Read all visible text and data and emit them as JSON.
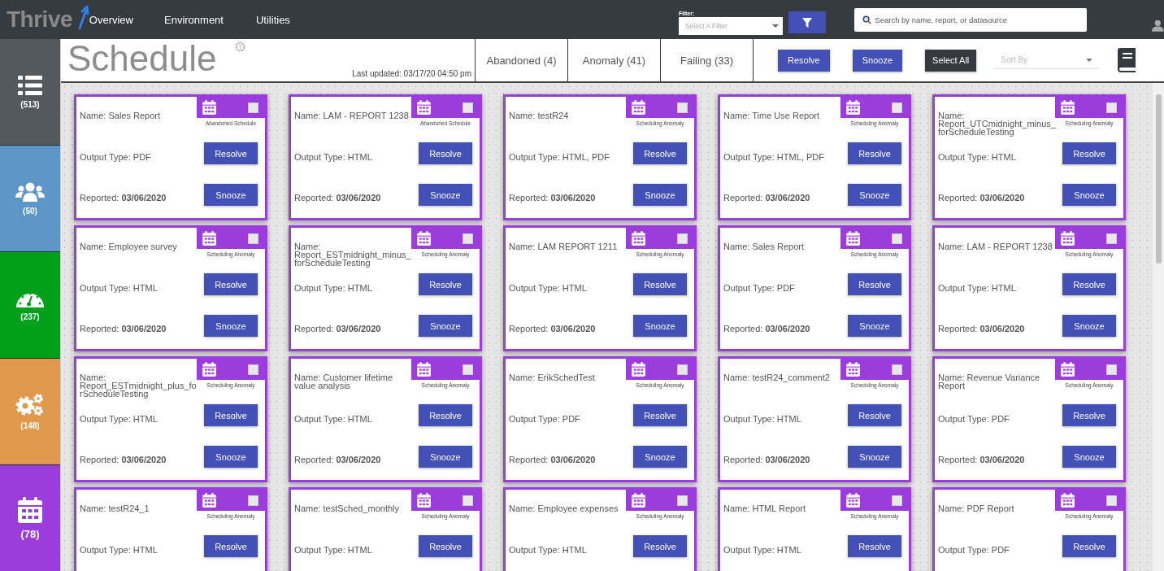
{
  "topbar": {
    "logo": "Thrive",
    "nav": [
      "Overview",
      "Environment",
      "Utilities"
    ],
    "filter": {
      "label": "Filter:",
      "placeholder": "Select A Filter"
    },
    "search": {
      "placeholder": "Search by name, report, or datasource"
    }
  },
  "sidebar": {
    "items": [
      {
        "kind": "list",
        "count": "(513)",
        "color": "#54595d"
      },
      {
        "kind": "users",
        "count": "(50)",
        "color": "#5b96c6"
      },
      {
        "kind": "gauge",
        "count": "(237)",
        "color": "#00a01b"
      },
      {
        "kind": "gears",
        "count": "(148)",
        "color": "#e0984a"
      },
      {
        "kind": "calendar",
        "count": "(78)",
        "color": "#9b3ddc"
      }
    ]
  },
  "header": {
    "title": "Schedule",
    "help": "?",
    "last_updated": "Last updated: 03/17/20 04:50 pm",
    "tabs": [
      {
        "label": "Abandoned (4)",
        "selected": false
      },
      {
        "label": "Anomaly (41)",
        "selected": false
      },
      {
        "label": "Failing (33)",
        "selected": false
      }
    ],
    "actions": [
      {
        "kind": "primary",
        "label": "Resolve"
      },
      {
        "kind": "primary",
        "label": "Snooze"
      },
      {
        "kind": "dark",
        "label": "Select All"
      }
    ],
    "sort": {
      "placeholder": "Sort By"
    }
  },
  "cards": [
    {
      "name": "Name: Sales Report",
      "output": "Output Type: PDF",
      "reported": "Reported: **03/06/2020**",
      "tag": "Abandoned Schedule",
      "checked": false,
      "resolve": "Resolve",
      "snooze": "Snooze"
    },
    {
      "name": "Name: LAM - REPORT 1238",
      "output": "Output Type: HTML",
      "reported": "Reported: **03/06/2020**",
      "tag": "Abandoned Schedule",
      "checked": false,
      "resolve": "Resolve",
      "snooze": "Snooze"
    },
    {
      "name": "Name: testR24",
      "output": "Output Type: HTML, PDF",
      "reported": "Reported: **03/06/2020**",
      "tag": "Scheduling Anomaly",
      "checked": false,
      "resolve": "Resolve",
      "snooze": "Snooze"
    },
    {
      "name": "Name: Time Use Report",
      "output": "Output Type: HTML, PDF",
      "reported": "Reported: **03/06/2020**",
      "tag": "Scheduling Anomaly",
      "checked": false,
      "resolve": "Resolve",
      "snooze": "Snooze"
    },
    {
      "name": "Name: Report_UTCmidnight_minus_forScheduleTesting",
      "output": "Output Type: HTML",
      "reported": "Reported: **03/06/2020**",
      "tag": "Scheduling Anomaly",
      "checked": false,
      "resolve": "Resolve",
      "snooze": "Snooze"
    },
    {
      "name": "Name: Employee survey",
      "output": "Output Type: HTML",
      "reported": "Reported: **03/06/2020**",
      "tag": "Scheduling Anomaly",
      "checked": false,
      "resolve": "Resolve",
      "snooze": "Snooze"
    },
    {
      "name": "Name: Report_ESTmidnight_minus_forScheduleTesting",
      "output": "Output Type: HTML",
      "reported": "Reported: **03/06/2020**",
      "tag": "Scheduling Anomaly",
      "checked": false,
      "resolve": "Resolve",
      "snooze": "Snooze"
    },
    {
      "name": "Name: LAM REPORT 1211",
      "output": "Output Type: HTML",
      "reported": "Reported: **03/06/2020**",
      "tag": "Scheduling Anomaly",
      "checked": false,
      "resolve": "Resolve",
      "snooze": "Snooze"
    },
    {
      "name": "Name: Sales Report",
      "output": "Output Type: PDF",
      "reported": "Reported: **03/06/2020**",
      "tag": "Scheduling Anomaly",
      "checked": false,
      "resolve": "Resolve",
      "snooze": "Snooze"
    },
    {
      "name": "Name: LAM - REPORT 1238",
      "output": "Output Type: HTML",
      "reported": "Reported: **03/06/2020**",
      "tag": "Scheduling Anomaly",
      "checked": false,
      "resolve": "Resolve",
      "snooze": "Snooze"
    },
    {
      "name": "Name: Report_ESTmidnight_plus_forScheduleTesting",
      "output": "Output Type: HTML",
      "reported": "Reported: **03/06/2020**",
      "tag": "Scheduling Anomaly",
      "checked": false,
      "resolve": "Resolve",
      "snooze": "Snooze"
    },
    {
      "name": "Name: Customer lifetime value analysis",
      "output": "Output Type: HTML",
      "reported": "Reported: **03/06/2020**",
      "tag": "Scheduling Anomaly",
      "checked": false,
      "resolve": "Resolve",
      "snooze": "Snooze"
    },
    {
      "name": "Name: ErikSchedTest",
      "output": "Output Type: PDF",
      "reported": "Reported: **03/06/2020**",
      "tag": "Scheduling Anomaly",
      "checked": false,
      "resolve": "Resolve",
      "snooze": "Snooze"
    },
    {
      "name": "Name: testR24_comment2",
      "output": "Output Type: HTML",
      "reported": "Reported: **03/06/2020**",
      "tag": "Scheduling Anomaly",
      "checked": false,
      "resolve": "Resolve",
      "snooze": "Snooze"
    },
    {
      "name": "Name: Revenue Variance Report",
      "output": "Output Type: PDF",
      "reported": "Reported: **03/06/2020**",
      "tag": "Scheduling Anomaly",
      "checked": false,
      "resolve": "Resolve",
      "snooze": "Snooze"
    },
    {
      "name": "Name: testR24_1",
      "output": "Output Type: HTML",
      "tag": "Scheduling Anomaly",
      "checked": false,
      "resolve": "Resolve"
    },
    {
      "name": "Name: testSched_monthly",
      "output": "Output Type: HTML",
      "tag": "Scheduling Anomaly",
      "checked": false,
      "resolve": "Resolve"
    },
    {
      "name": "Name: Employee expenses",
      "output": "Output Type: HTML",
      "tag": "Scheduling Anomaly",
      "checked": false,
      "resolve": "Resolve"
    },
    {
      "name": "Name: HTML Report",
      "output": "Output Type: HTML",
      "tag": "Scheduling Anomaly",
      "checked": false,
      "resolve": "Resolve"
    },
    {
      "name": "Name: PDF Report",
      "output": "Output Type: PDF",
      "tag": "Scheduling Anomaly",
      "checked": false,
      "resolve": "Resolve"
    }
  ]
}
